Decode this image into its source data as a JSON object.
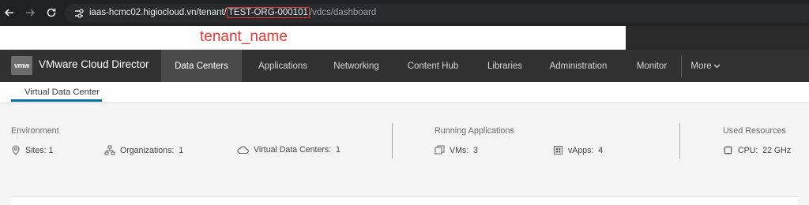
{
  "browser": {
    "url_prefix": "iaas-hcmc02.higiocloud.vn/tenant/",
    "url_highlight": "TEST-ORG-000101",
    "url_suffix": "/vdcs/dashboard",
    "annotation": "tenant_name"
  },
  "header": {
    "logo_text": "vmw",
    "app_title": "VMware Cloud Director",
    "nav": [
      {
        "label": "Data Centers",
        "active": true
      },
      {
        "label": "Applications"
      },
      {
        "label": "Networking"
      },
      {
        "label": "Content Hub"
      },
      {
        "label": "Libraries"
      },
      {
        "label": "Administration"
      },
      {
        "label": "Monitor"
      },
      {
        "label": "More"
      }
    ]
  },
  "subnav": {
    "tab": "Virtual Data Center"
  },
  "summary": {
    "environment": {
      "title": "Environment",
      "sites_label": "Sites:",
      "sites_value": "1",
      "orgs_label": "Organizations:",
      "orgs_value": "1",
      "vdcs_label": "Virtual Data Centers:",
      "vdcs_value": "1"
    },
    "running": {
      "title": "Running Applications",
      "vms_label": "VMs:",
      "vms_value": "3",
      "vapps_label": "vApps:",
      "vapps_value": "4"
    },
    "resources": {
      "title": "Used Resources",
      "cpu_label": "CPU:",
      "cpu_value": "22 GHz"
    }
  },
  "colors": {
    "header_bg": "#313131",
    "accent": "#0072a3",
    "annotation": "#e53935"
  }
}
